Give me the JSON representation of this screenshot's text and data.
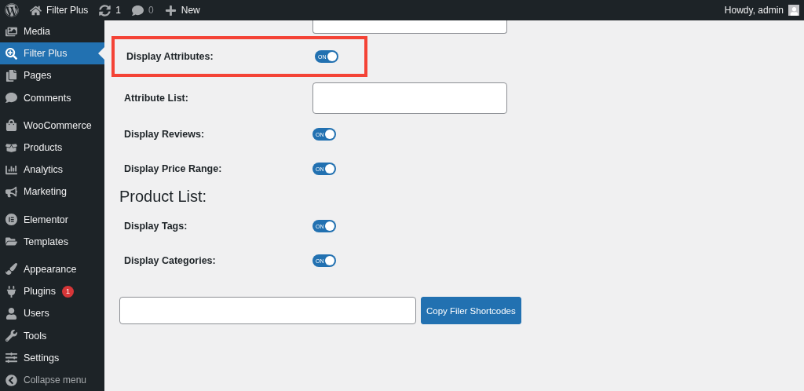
{
  "admin_bar": {
    "site": "Filter Plus",
    "updates": "1",
    "comments": "0",
    "new": "New",
    "greeting": "Howdy, admin"
  },
  "sidebar": {
    "groups": [
      [
        {
          "label": "Media",
          "selected": false
        },
        {
          "label": "Filter Plus",
          "selected": true
        },
        {
          "label": "Pages",
          "selected": false
        },
        {
          "label": "Comments",
          "selected": false
        }
      ],
      [
        {
          "label": "WooCommerce",
          "selected": false
        },
        {
          "label": "Products",
          "selected": false
        },
        {
          "label": "Analytics",
          "selected": false
        },
        {
          "label": "Marketing",
          "selected": false
        }
      ],
      [
        {
          "label": "Elementor",
          "selected": false
        },
        {
          "label": "Templates",
          "selected": false
        }
      ],
      [
        {
          "label": "Appearance",
          "selected": false
        },
        {
          "label": "Plugins",
          "selected": false,
          "badge": "1"
        },
        {
          "label": "Users",
          "selected": false
        },
        {
          "label": "Tools",
          "selected": false
        },
        {
          "label": "Settings",
          "selected": false
        }
      ]
    ],
    "collapse": "Collapse menu"
  },
  "settings": [
    {
      "kind": "toggle",
      "label": "Display Attributes:",
      "on": true,
      "highlighted": true,
      "toggle_text": "ON"
    },
    {
      "kind": "field",
      "label": "Attribute List:",
      "highlighted": false
    },
    {
      "kind": "toggle",
      "label": "Display Reviews:",
      "on": true,
      "highlighted": false,
      "toggle_text": "ON"
    },
    {
      "kind": "toggle",
      "label": "Display Price Range:",
      "on": true,
      "highlighted": false,
      "toggle_text": "ON"
    },
    {
      "kind": "heading",
      "label": "Product List:"
    },
    {
      "kind": "toggle",
      "label": "Display Tags:",
      "on": true,
      "highlighted": false,
      "toggle_text": "ON"
    },
    {
      "kind": "toggle",
      "label": "Display Categories:",
      "on": true,
      "highlighted": false,
      "toggle_text": "ON"
    }
  ],
  "shortcode": {
    "button": "Copy Filer Shortcodes"
  }
}
